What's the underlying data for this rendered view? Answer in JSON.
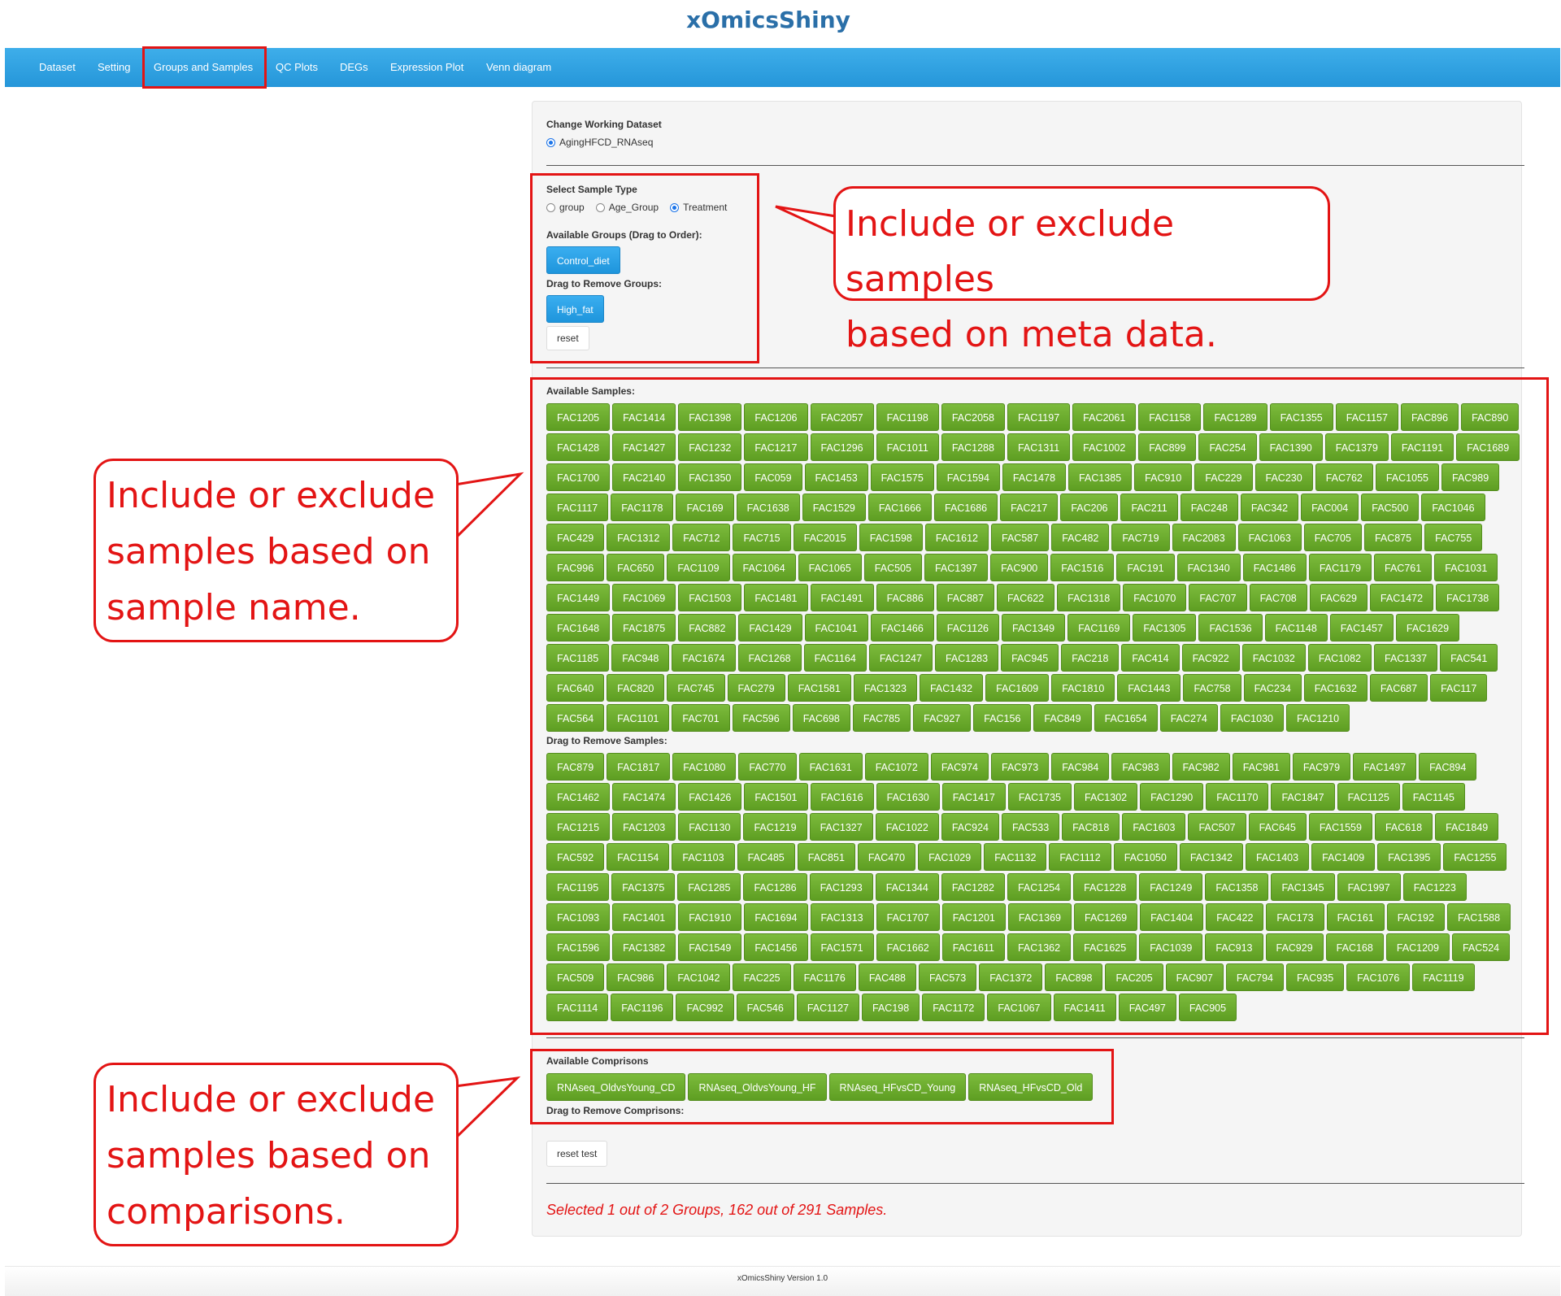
{
  "app": {
    "title": "xOmicsShiny"
  },
  "nav": {
    "items": [
      {
        "label": "Dataset"
      },
      {
        "label": "Setting"
      },
      {
        "label": "Groups and Samples"
      },
      {
        "label": "QC Plots"
      },
      {
        "label": "DEGs"
      },
      {
        "label": "Expression Plot"
      },
      {
        "label": "Venn diagram"
      }
    ],
    "active": "Groups and Samples"
  },
  "dataset": {
    "label": "Change Working Dataset",
    "option": "AgingHFCD_RNAseq"
  },
  "sample_type": {
    "label": "Select Sample Type",
    "options": [
      "group",
      "Age_Group",
      "Treatment"
    ],
    "selected": "Treatment"
  },
  "groups": {
    "available_label": "Available Groups (Drag to Order):",
    "available": [
      "Control_diet"
    ],
    "remove_label": "Drag to Remove Groups:",
    "removed": [
      "High_fat"
    ],
    "reset_label": "reset"
  },
  "samples": {
    "available_label": "Available Samples:",
    "available": [
      "FAC1205",
      "FAC1414",
      "FAC1398",
      "FAC1206",
      "FAC2057",
      "FAC1198",
      "FAC2058",
      "FAC1197",
      "FAC2061",
      "FAC1158",
      "FAC1289",
      "FAC1355",
      "FAC1157",
      "FAC896",
      "FAC890",
      "FAC1428",
      "FAC1427",
      "FAC1232",
      "FAC1217",
      "FAC1296",
      "FAC1011",
      "FAC1288",
      "FAC1311",
      "FAC1002",
      "FAC899",
      "FAC254",
      "FAC1390",
      "FAC1379",
      "FAC1191",
      "FAC1689",
      "FAC1700",
      "FAC2140",
      "FAC1350",
      "FAC059",
      "FAC1453",
      "FAC1575",
      "FAC1594",
      "FAC1478",
      "FAC1385",
      "FAC910",
      "FAC229",
      "FAC230",
      "FAC762",
      "FAC1055",
      "FAC989",
      "FAC1117",
      "FAC1178",
      "FAC169",
      "FAC1638",
      "FAC1529",
      "FAC1666",
      "FAC1686",
      "FAC217",
      "FAC206",
      "FAC211",
      "FAC248",
      "FAC342",
      "FAC004",
      "FAC500",
      "FAC1046",
      "FAC429",
      "FAC1312",
      "FAC712",
      "FAC715",
      "FAC2015",
      "FAC1598",
      "FAC1612",
      "FAC587",
      "FAC482",
      "FAC719",
      "FAC2083",
      "FAC1063",
      "FAC705",
      "FAC875",
      "FAC755",
      "FAC996",
      "FAC650",
      "FAC1109",
      "FAC1064",
      "FAC1065",
      "FAC505",
      "FAC1397",
      "FAC900",
      "FAC1516",
      "FAC191",
      "FAC1340",
      "FAC1486",
      "FAC1179",
      "FAC761",
      "FAC1031",
      "FAC1449",
      "FAC1069",
      "FAC1503",
      "FAC1481",
      "FAC1491",
      "FAC886",
      "FAC887",
      "FAC622",
      "FAC1318",
      "FAC1070",
      "FAC707",
      "FAC708",
      "FAC629",
      "FAC1472",
      "FAC1738",
      "FAC1648",
      "FAC1875",
      "FAC882",
      "FAC1429",
      "FAC1041",
      "FAC1466",
      "FAC1126",
      "FAC1349",
      "FAC1169",
      "FAC1305",
      "FAC1536",
      "FAC1148",
      "FAC1457",
      "FAC1629",
      "FAC1185",
      "FAC948",
      "FAC1674",
      "FAC1268",
      "FAC1164",
      "FAC1247",
      "FAC1283",
      "FAC945",
      "FAC218",
      "FAC414",
      "FAC922",
      "FAC1032",
      "FAC1082",
      "FAC1337",
      "FAC541",
      "FAC640",
      "FAC820",
      "FAC745",
      "FAC279",
      "FAC1581",
      "FAC1323",
      "FAC1432",
      "FAC1609",
      "FAC1810",
      "FAC1443",
      "FAC758",
      "FAC234",
      "FAC1632",
      "FAC687",
      "FAC117",
      "FAC564",
      "FAC1101",
      "FAC701",
      "FAC596",
      "FAC698",
      "FAC785",
      "FAC927",
      "FAC156",
      "FAC849",
      "FAC1654",
      "FAC274",
      "FAC1030",
      "FAC1210"
    ],
    "remove_label": "Drag to Remove Samples:",
    "removed": [
      "FAC879",
      "FAC1817",
      "FAC1080",
      "FAC770",
      "FAC1631",
      "FAC1072",
      "FAC974",
      "FAC973",
      "FAC984",
      "FAC983",
      "FAC982",
      "FAC981",
      "FAC979",
      "FAC1497",
      "FAC894",
      "FAC1462",
      "FAC1474",
      "FAC1426",
      "FAC1501",
      "FAC1616",
      "FAC1630",
      "FAC1417",
      "FAC1735",
      "FAC1302",
      "FAC1290",
      "FAC1170",
      "FAC1847",
      "FAC1125",
      "FAC1145",
      "FAC1215",
      "FAC1203",
      "FAC1130",
      "FAC1219",
      "FAC1327",
      "FAC1022",
      "FAC924",
      "FAC533",
      "FAC818",
      "FAC1603",
      "FAC507",
      "FAC645",
      "FAC1559",
      "FAC618",
      "FAC1849",
      "FAC592",
      "FAC1154",
      "FAC1103",
      "FAC485",
      "FAC851",
      "FAC470",
      "FAC1029",
      "FAC1132",
      "FAC1112",
      "FAC1050",
      "FAC1342",
      "FAC1403",
      "FAC1409",
      "FAC1395",
      "FAC1255",
      "FAC1195",
      "FAC1375",
      "FAC1285",
      "FAC1286",
      "FAC1293",
      "FAC1344",
      "FAC1282",
      "FAC1254",
      "FAC1228",
      "FAC1249",
      "FAC1358",
      "FAC1345",
      "FAC1997",
      "FAC1223",
      "FAC1093",
      "FAC1401",
      "FAC1910",
      "FAC1694",
      "FAC1313",
      "FAC1707",
      "FAC1201",
      "FAC1369",
      "FAC1269",
      "FAC1404",
      "FAC422",
      "FAC173",
      "FAC161",
      "FAC192",
      "FAC1588",
      "FAC1596",
      "FAC1382",
      "FAC1549",
      "FAC1456",
      "FAC1571",
      "FAC1662",
      "FAC1611",
      "FAC1362",
      "FAC1625",
      "FAC1039",
      "FAC913",
      "FAC929",
      "FAC168",
      "FAC1209",
      "FAC524",
      "FAC509",
      "FAC986",
      "FAC1042",
      "FAC225",
      "FAC1176",
      "FAC488",
      "FAC573",
      "FAC1372",
      "FAC898",
      "FAC205",
      "FAC907",
      "FAC794",
      "FAC935",
      "FAC1076",
      "FAC1119",
      "FAC1114",
      "FAC1196",
      "FAC992",
      "FAC546",
      "FAC1127",
      "FAC198",
      "FAC1172",
      "FAC1067",
      "FAC1411",
      "FAC497",
      "FAC905"
    ]
  },
  "comparisons": {
    "available_label": "Available Comprisons",
    "available": [
      "RNAseq_OldvsYoung_CD",
      "RNAseq_OldvsYoung_HF",
      "RNAseq_HFvsCD_Young",
      "RNAseq_HFvsCD_Old"
    ],
    "remove_label": "Drag to Remove Comprisons:",
    "reset_label": "reset test"
  },
  "status": {
    "text": "Selected 1 out of 2 Groups, 162 out of 291 Samples."
  },
  "footer": {
    "text": "xOmicsShiny Version 1.0"
  },
  "callouts": {
    "meta": "Include or exclude samples\nbased on meta data.",
    "name": "Include or exclude\nsamples based on\nsample name.",
    "comparisons": "Include or exclude\nsamples based on\ncomparisons."
  },
  "colors": {
    "navbar": "#2596d9",
    "accent_blue": "#1e95dc",
    "chip_green": "#6aa92e",
    "annotation_red": "#e31414",
    "title_blue": "#2a6fa8"
  }
}
